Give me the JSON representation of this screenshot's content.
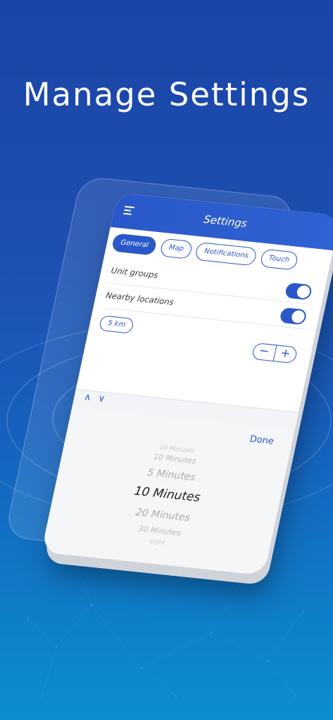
{
  "headline": "Manage Settings",
  "app": {
    "title": "Settings",
    "tabs": [
      "General",
      "Map",
      "Notifications",
      "Touch"
    ],
    "active_tab": "General"
  },
  "settings": {
    "unit_groups_label": "Unit groups",
    "nearby_locations_label": "Nearby locations",
    "radius_value": "5 km",
    "stepper_minus": "−",
    "stepper_plus": "+"
  },
  "picker": {
    "up_arrow": "∧",
    "down_arrow": "∨",
    "done_label": "Done",
    "options": [
      "10 Minutes",
      "10 Minutes",
      "5 Minutes",
      "10 Minutes",
      "20 Minutes",
      "30 Minutes",
      "Eight"
    ],
    "selected_option": "10 Minutes"
  },
  "colors": {
    "accent": "#2a58c9",
    "background_top": "#1b44a8",
    "background_bottom": "#0b8ed1"
  },
  "icons": {
    "menu": "menu-icon",
    "up": "chevron-up-icon",
    "down": "chevron-down-icon"
  }
}
